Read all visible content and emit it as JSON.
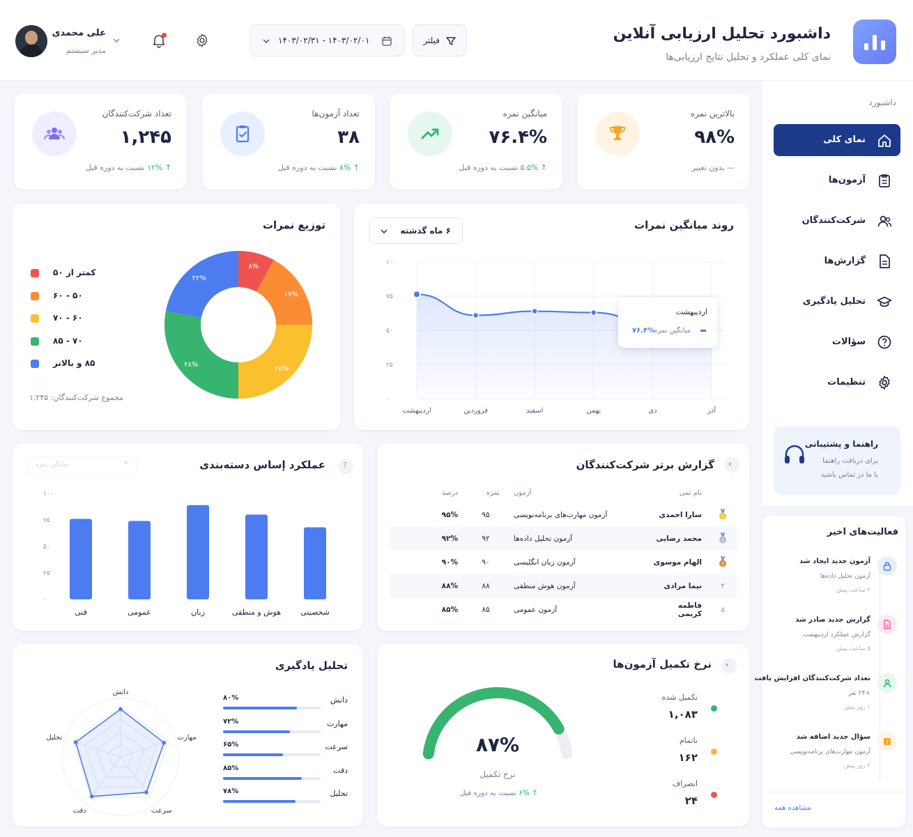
{
  "header": {
    "title": "داشبورد تحلیل ارزیابی آنلاین",
    "subtitle": "نمای کلی عملکرد و تحلیل نتایج ارزیابی‌ها",
    "filter_label": "فیلتر",
    "date_range": "۱۴۰۳/۰۲/۰۱ - ۱۴۰۳/۰۲/۳۱",
    "user_name": "علی محمدی",
    "user_role": "مدیر سیستم"
  },
  "sidebar": {
    "section_label": "داشبورد",
    "items": [
      {
        "label": "نمای کلی",
        "icon": "home-icon",
        "active": true
      },
      {
        "label": "آزمون‌ها",
        "icon": "clipboard-icon",
        "active": false
      },
      {
        "label": "شرکت‌کنندگان",
        "icon": "users-icon",
        "active": false
      },
      {
        "label": "گزارش‌ها",
        "icon": "document-icon",
        "active": false
      },
      {
        "label": "تحلیل یادگیری",
        "icon": "graduation-cap-icon",
        "active": false
      },
      {
        "label": "سؤالات",
        "icon": "question-icon",
        "active": false
      },
      {
        "label": "تنظیمات",
        "icon": "gear-icon",
        "active": false
      }
    ],
    "help_title": "راهنما و پشتیبانی",
    "help_line1": "برای دریافت راهنما",
    "help_line2": "با ما در تماس باشید"
  },
  "stats": [
    {
      "label": "بالاترین نمره",
      "value": "۹۸%",
      "change": "— بدون تغییر",
      "color": "#f6a623",
      "bg": "#fff4e3",
      "icon": "trophy-icon"
    },
    {
      "label": "میانگین نمره",
      "value": "۷۶.۴%",
      "change_val": "↑ ۵.۵%",
      "change_text": " نسبت به دوره قبل",
      "color": "#2bb673",
      "bg": "#e6f7ee",
      "icon": "trend-up-icon"
    },
    {
      "label": "تعداد آزمون‌ها",
      "value": "۳۸",
      "change_val": "↑ ۸%",
      "change_text": " نسبت به دوره قبل",
      "color": "#4d7cf0",
      "bg": "#e8efff",
      "icon": "clipboard-check-icon"
    },
    {
      "label": "تعداد شرکت‌کنندگان",
      "value": "۱,۲۴۵",
      "change_val": "↑ ۱۲%",
      "change_text": " نسبت به دوره قبل",
      "color": "#7a6ff0",
      "bg": "#efedff",
      "icon": "users-icon"
    }
  ],
  "trend": {
    "title": "روند میانگین نمرات",
    "dropdown": "۶ ماه گذشته",
    "tooltip_month": "اردیبهشت",
    "tooltip_label": "میانگین نمره",
    "tooltip_value": "۷۶.۴%",
    "chart_data": {
      "type": "area",
      "categories": [
        "آذر",
        "دی",
        "بهمن",
        "اسفند",
        "فروردین",
        "اردیبهشت"
      ],
      "values": [
        62,
        55,
        63,
        64,
        61,
        76.4
      ],
      "yticks": [
        "۰",
        "۲۵",
        "۵۰",
        "۷۵",
        "۱۰۰"
      ],
      "ylim": [
        0,
        100
      ]
    }
  },
  "distribution": {
    "title": "توزیع نمرات",
    "total_label": "مجموع شرکت‌کنندگان: ۱,۲۴۵",
    "chart_data": {
      "type": "pie",
      "labels": [
        "کمتر از ۵۰",
        "۵۰ - ۶۰",
        "۶۰ - ۷۰",
        "۷۰ - ۸۵",
        "۸۵ و بالاتر"
      ],
      "values": [
        8,
        17,
        25,
        28,
        22
      ],
      "value_labels": [
        "۸%",
        "۱۷%",
        "۲۵%",
        "۲۸%",
        "۲۲%"
      ],
      "colors": [
        "#ef5350",
        "#fb8c34",
        "#fbc02d",
        "#37b46f",
        "#4d7cf0"
      ]
    }
  },
  "top_report": {
    "title": "گزارش برتر شرکت‌کنندگان",
    "columns": [
      "نام تمی",
      "آزمون",
      "نمره",
      "درصد"
    ],
    "rows": [
      {
        "rank": "1",
        "name": "سارا احمدی",
        "exam": "آزمون مهارت‌های برنامه‌نویسی",
        "score": "۹۵",
        "percent": "۹۵%"
      },
      {
        "rank": "2",
        "name": "محمد رضایی",
        "exam": "آزمون تحلیل داده‌ها",
        "score": "۹۲",
        "percent": "۹۲%"
      },
      {
        "rank": "3",
        "name": "الهام موسوی",
        "exam": "آزمون زبان انگلیسی",
        "score": "۹۰",
        "percent": "۹۰%"
      },
      {
        "rank": "۴",
        "name": "نیما مرادی",
        "exam": "آزمون هوش منطقی",
        "score": "۸۸",
        "percent": "۸۸%"
      },
      {
        "rank": "۵",
        "name": "فاطمه کریمی",
        "exam": "آزمون عمومی",
        "score": "۸۵",
        "percent": "۸۵%"
      }
    ]
  },
  "category": {
    "title": "عملکرد إساس دسته‌بندی",
    "select_placeholder": "میانگین نمره",
    "chart_data": {
      "type": "bar",
      "categories": [
        "شخصیتی",
        "هوش و منطقی",
        "زبان",
        "عمومی",
        "فنی"
      ],
      "values": [
        68,
        80,
        89,
        74,
        76
      ],
      "yticks": [
        "۰",
        "۲۵",
        "۵۰",
        "۷۵",
        "۱۰۰"
      ],
      "ylim": [
        0,
        100
      ]
    }
  },
  "learning": {
    "title": "تحلیل یادگیری",
    "items": [
      {
        "label": "دانش",
        "value": 80,
        "text": "۸۰%"
      },
      {
        "label": "مهارت",
        "value": 72,
        "text": "۷۲%"
      },
      {
        "label": "سرعت",
        "value": 65,
        "text": "۶۵%"
      },
      {
        "label": "دقت",
        "value": 85,
        "text": "۸۵%"
      },
      {
        "label": "تحلیل",
        "value": 78,
        "text": "۷۸%"
      }
    ]
  },
  "completion": {
    "title": "نرخ تکمیل آزمون‌ها",
    "percent": 87,
    "percent_text": "۸۷%",
    "label": "نرخ تکمیل",
    "change_val": "↑ ۶%",
    "change_text": " نسبت به دوره قبل",
    "legend": [
      {
        "label": "تکمیل شده",
        "value": "۱,۰۸۳",
        "color": "#37b46f"
      },
      {
        "label": "ناتمام",
        "value": "۱۶۲",
        "color": "#fbb040"
      },
      {
        "label": "انصراف",
        "value": "۲۴",
        "color": "#ef5350"
      }
    ]
  },
  "activities": {
    "title": "فعالیت‌های اخیر",
    "items": [
      {
        "title": "آزمون جدید ایجاد شد",
        "desc": "آزمون تحلیل داده‌ها",
        "time": "۲ ساعت پیش",
        "color": "#4d7cf0",
        "bg": "#e8efff",
        "icon": "lock-icon"
      },
      {
        "title": "گزارش جدید صادر شد",
        "desc": "گزارش عملکرد اردیبهشت",
        "time": "۵ ساعت پیش",
        "color": "#e85d9c",
        "bg": "#fde8f1",
        "icon": "document-icon"
      },
      {
        "title": "تعداد شرکت‌کنندگان افزایش یافت",
        "desc": "+۲۴ نفر",
        "time": "۱ روز پیش",
        "color": "#2bb673",
        "bg": "#e6f7ee",
        "icon": "user-icon"
      },
      {
        "title": "سؤال جدید اضافه شد",
        "desc": "آزمون مهارت‌های برنامه‌نویسی",
        "time": "۲ روز پیش",
        "color": "#f6a623",
        "bg": "#fff4e3",
        "icon": "question-icon"
      }
    ],
    "view_all": "مشاهده همه"
  }
}
